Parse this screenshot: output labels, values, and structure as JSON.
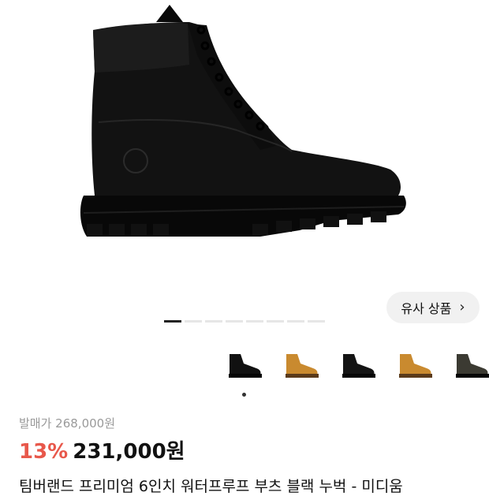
{
  "similar_button": {
    "label": "유사 상품",
    "chevron": "chevron-right-icon"
  },
  "gallery": {
    "image_count": 8,
    "active_index": 0,
    "hero_icon": "black-boot-image"
  },
  "thumbnails": [
    {
      "name": "black-boot-thumb",
      "color": "#111111"
    },
    {
      "name": "wheat-boot-thumb",
      "color": "#c98a2f"
    },
    {
      "name": "black-boot-thumb-2",
      "color": "#141414"
    },
    {
      "name": "wheat-boot-thumb-2",
      "color": "#c98a2f"
    },
    {
      "name": "dark-olive-boot-thumb",
      "color": "#3b3a32"
    }
  ],
  "price": {
    "original": "발매가 268,000원",
    "discount": "13%",
    "current": "231,000원"
  },
  "product": {
    "title": "팀버랜드 프리미엄 6인치 워터프루프 부츠 블랙 누벅 - 미디움"
  },
  "colors": {
    "discount": "#e8584b",
    "boot_main": "#111111",
    "wheat": "#c98a2f",
    "olive": "#3b3a32"
  }
}
